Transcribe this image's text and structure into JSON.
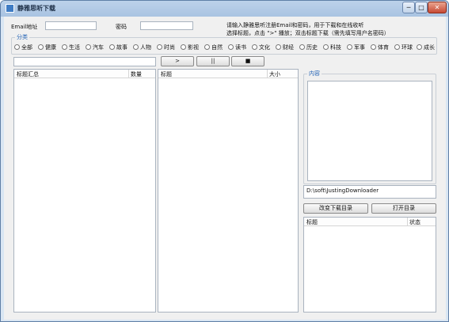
{
  "window": {
    "title": "静雅思听下载",
    "controls": {
      "minimize": "─",
      "maximize": "□",
      "close": "✕"
    }
  },
  "login": {
    "email_label": "Email地址",
    "email_value": "",
    "password_label": "密码",
    "password_value": ""
  },
  "hints": {
    "line1": "请输入静雅思听注册Email和密码，用于下载和在线收听",
    "line2": "选择标题，点击 \">\" 播放；双击标题下载（需先填写用户名密码）"
  },
  "category": {
    "label": "分类",
    "options": [
      "全部",
      "健康",
      "生活",
      "汽车",
      "故事",
      "人物",
      "时尚",
      "影视",
      "自然",
      "读书",
      "文化",
      "财经",
      "历史",
      "科技",
      "军事",
      "体育",
      "环球",
      "成长"
    ]
  },
  "toolbar": {
    "search_value": "",
    "play_label": ">",
    "pause_label": "||",
    "stop_label": "■"
  },
  "summary_list": {
    "col_title": "标题汇总",
    "col_count": "数量"
  },
  "episode_list": {
    "col_title": "标题",
    "col_size": "大小"
  },
  "content": {
    "label": "内容"
  },
  "download": {
    "path": "D:\\soft\\JustingDownloader",
    "change_dir_label": "改变下载目录",
    "open_dir_label": "打开目录"
  },
  "task_list": {
    "col_title": "标题",
    "col_status": "状态"
  }
}
